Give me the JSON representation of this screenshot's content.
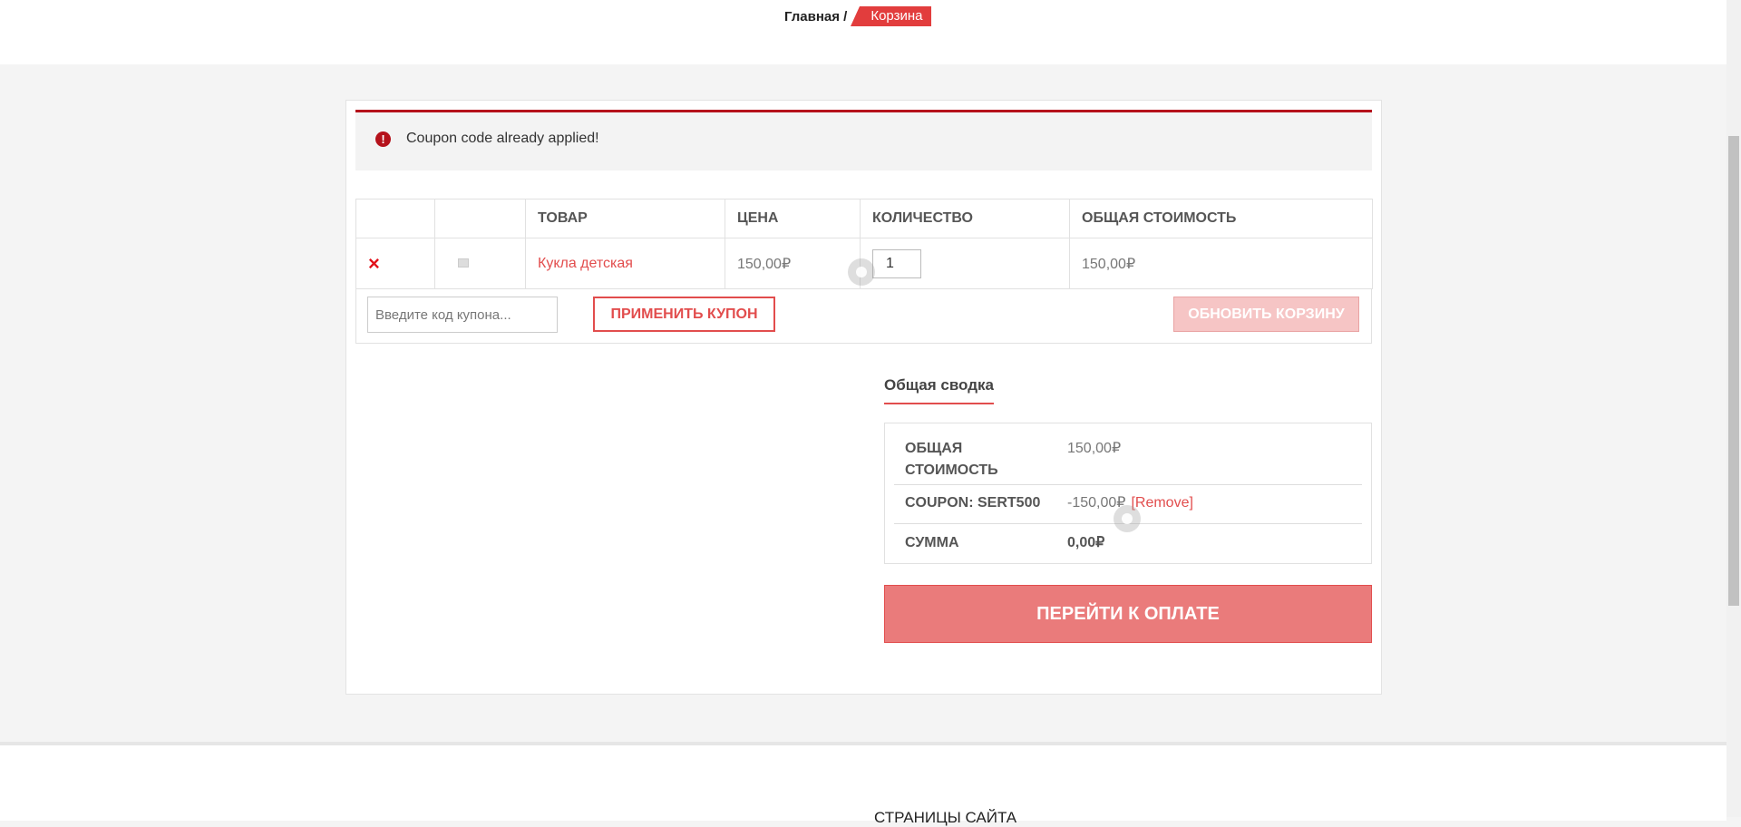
{
  "breadcrumb": {
    "home": "Главная /",
    "current": "Корзина"
  },
  "notice": {
    "icon": "alert-icon",
    "text": "Coupon code already applied!"
  },
  "cart": {
    "headers": [
      "",
      "",
      "ТОВАР",
      "ЦЕНА",
      "КОЛИЧЕСТВО",
      "ОБЩАЯ СТОИМОСТЬ"
    ],
    "items": [
      {
        "remove": "×",
        "product": "Кукла детская",
        "price": "150,00₽",
        "quantity": "1",
        "subtotal": "150,00₽"
      }
    ],
    "coupon_placeholder": "Введите код купона...",
    "apply_label": "ПРИМЕНИТЬ КУПОН",
    "update_label": "ОБНОВИТЬ КОРЗИНУ"
  },
  "totals": {
    "title": "Общая сводка",
    "subtotal_label": "ОБЩАЯ СТОИМОСТЬ",
    "subtotal_value": "150,00₽",
    "coupon_label": "COUPON: SERT500",
    "coupon_value": "-150,00₽",
    "coupon_remove": "[Remove]",
    "total_label": "СУММА",
    "total_value": "0,00₽",
    "checkout_label": "ПЕРЕЙТИ К ОПЛАТЕ"
  },
  "footer": {
    "title": "СТРАНИЦЫ САЙТА"
  },
  "colors": {
    "accent": "#e24d4d",
    "error": "#b5121b",
    "checkout_bg": "#ea7b7b"
  }
}
